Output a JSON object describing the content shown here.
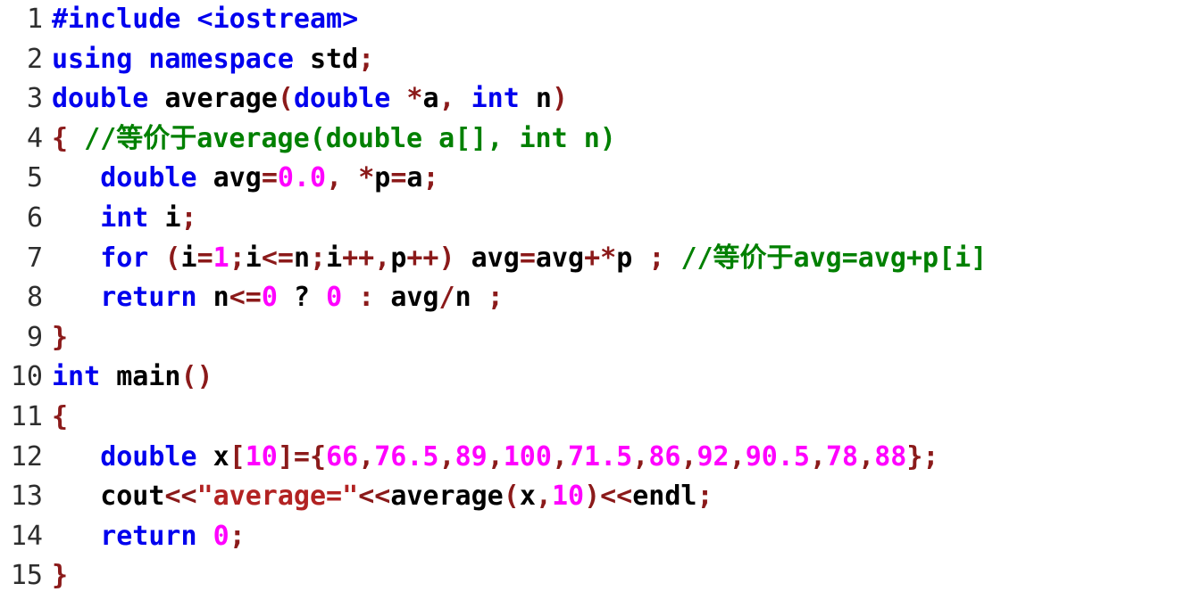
{
  "editor": {
    "language": "C++",
    "colors": {
      "background": "#ffffff",
      "line_number": "#2e2e2e",
      "keyword": "#0000ee",
      "punctuation": "#8b1a1a",
      "number": "#ff00ff",
      "string": "#b22222",
      "comment": "#008000",
      "plain": "#000000"
    },
    "lines": [
      {
        "number": "1",
        "tokens": [
          {
            "text": "#include <iostream>",
            "type": "key"
          }
        ]
      },
      {
        "number": "2",
        "tokens": [
          {
            "text": "using namespace ",
            "type": "key"
          },
          {
            "text": "std",
            "type": "plain"
          },
          {
            "text": ";",
            "type": "punc"
          }
        ]
      },
      {
        "number": "3",
        "tokens": [
          {
            "text": "double ",
            "type": "key"
          },
          {
            "text": "average",
            "type": "plain"
          },
          {
            "text": "(",
            "type": "punc"
          },
          {
            "text": "double ",
            "type": "key"
          },
          {
            "text": "*",
            "type": "punc"
          },
          {
            "text": "a",
            "type": "plain"
          },
          {
            "text": ", ",
            "type": "punc"
          },
          {
            "text": "int ",
            "type": "key"
          },
          {
            "text": "n",
            "type": "plain"
          },
          {
            "text": ")",
            "type": "punc"
          }
        ]
      },
      {
        "number": "4",
        "tokens": [
          {
            "text": "{ ",
            "type": "punc"
          },
          {
            "text": "//等价于average(double a[], int n)",
            "type": "cmt"
          }
        ]
      },
      {
        "number": "5",
        "tokens": [
          {
            "text": "   ",
            "type": "plain"
          },
          {
            "text": "double ",
            "type": "key"
          },
          {
            "text": "avg",
            "type": "plain"
          },
          {
            "text": "=",
            "type": "punc"
          },
          {
            "text": "0.0",
            "type": "num"
          },
          {
            "text": ", ",
            "type": "punc"
          },
          {
            "text": "*",
            "type": "punc"
          },
          {
            "text": "p",
            "type": "plain"
          },
          {
            "text": "=",
            "type": "punc"
          },
          {
            "text": "a",
            "type": "plain"
          },
          {
            "text": ";",
            "type": "punc"
          }
        ]
      },
      {
        "number": "6",
        "tokens": [
          {
            "text": "   ",
            "type": "plain"
          },
          {
            "text": "int ",
            "type": "key"
          },
          {
            "text": "i",
            "type": "plain"
          },
          {
            "text": ";",
            "type": "punc"
          }
        ]
      },
      {
        "number": "7",
        "tokens": [
          {
            "text": "   ",
            "type": "plain"
          },
          {
            "text": "for ",
            "type": "key"
          },
          {
            "text": "(",
            "type": "punc"
          },
          {
            "text": "i",
            "type": "plain"
          },
          {
            "text": "=",
            "type": "punc"
          },
          {
            "text": "1",
            "type": "num"
          },
          {
            "text": ";",
            "type": "punc"
          },
          {
            "text": "i",
            "type": "plain"
          },
          {
            "text": "<=",
            "type": "punc"
          },
          {
            "text": "n",
            "type": "plain"
          },
          {
            "text": ";",
            "type": "punc"
          },
          {
            "text": "i",
            "type": "plain"
          },
          {
            "text": "++",
            "type": "punc"
          },
          {
            "text": ",",
            "type": "punc"
          },
          {
            "text": "p",
            "type": "plain"
          },
          {
            "text": "++",
            "type": "punc"
          },
          {
            "text": ") ",
            "type": "punc"
          },
          {
            "text": "avg",
            "type": "plain"
          },
          {
            "text": "=",
            "type": "punc"
          },
          {
            "text": "avg",
            "type": "plain"
          },
          {
            "text": "+",
            "type": "punc"
          },
          {
            "text": "*",
            "type": "punc"
          },
          {
            "text": "p ",
            "type": "plain"
          },
          {
            "text": "; ",
            "type": "punc"
          },
          {
            "text": "//等价于avg=avg+p[i]",
            "type": "cmt"
          }
        ]
      },
      {
        "number": "8",
        "tokens": [
          {
            "text": "   ",
            "type": "plain"
          },
          {
            "text": "return ",
            "type": "key"
          },
          {
            "text": "n",
            "type": "plain"
          },
          {
            "text": "<=",
            "type": "punc"
          },
          {
            "text": "0",
            "type": "num"
          },
          {
            "text": " ? ",
            "type": "plain"
          },
          {
            "text": "0",
            "type": "num"
          },
          {
            "text": " : ",
            "type": "punc"
          },
          {
            "text": "avg",
            "type": "plain"
          },
          {
            "text": "/",
            "type": "punc"
          },
          {
            "text": "n ",
            "type": "plain"
          },
          {
            "text": ";",
            "type": "punc"
          }
        ]
      },
      {
        "number": "9",
        "tokens": [
          {
            "text": "}",
            "type": "punc"
          }
        ]
      },
      {
        "number": "10",
        "tokens": [
          {
            "text": "int ",
            "type": "key"
          },
          {
            "text": "main",
            "type": "plain"
          },
          {
            "text": "()",
            "type": "punc"
          }
        ]
      },
      {
        "number": "11",
        "tokens": [
          {
            "text": "{",
            "type": "punc"
          }
        ]
      },
      {
        "number": "12",
        "tokens": [
          {
            "text": "   ",
            "type": "plain"
          },
          {
            "text": "double ",
            "type": "key"
          },
          {
            "text": "x",
            "type": "plain"
          },
          {
            "text": "[",
            "type": "punc"
          },
          {
            "text": "10",
            "type": "num"
          },
          {
            "text": "]={",
            "type": "punc"
          },
          {
            "text": "66",
            "type": "num"
          },
          {
            "text": ",",
            "type": "punc"
          },
          {
            "text": "76.5",
            "type": "num"
          },
          {
            "text": ",",
            "type": "punc"
          },
          {
            "text": "89",
            "type": "num"
          },
          {
            "text": ",",
            "type": "punc"
          },
          {
            "text": "100",
            "type": "num"
          },
          {
            "text": ",",
            "type": "punc"
          },
          {
            "text": "71.5",
            "type": "num"
          },
          {
            "text": ",",
            "type": "punc"
          },
          {
            "text": "86",
            "type": "num"
          },
          {
            "text": ",",
            "type": "punc"
          },
          {
            "text": "92",
            "type": "num"
          },
          {
            "text": ",",
            "type": "punc"
          },
          {
            "text": "90.5",
            "type": "num"
          },
          {
            "text": ",",
            "type": "punc"
          },
          {
            "text": "78",
            "type": "num"
          },
          {
            "text": ",",
            "type": "punc"
          },
          {
            "text": "88",
            "type": "num"
          },
          {
            "text": "};",
            "type": "punc"
          }
        ]
      },
      {
        "number": "13",
        "tokens": [
          {
            "text": "   ",
            "type": "plain"
          },
          {
            "text": "cout",
            "type": "plain"
          },
          {
            "text": "<<",
            "type": "punc"
          },
          {
            "text": "\"average=\"",
            "type": "str"
          },
          {
            "text": "<<",
            "type": "punc"
          },
          {
            "text": "average",
            "type": "plain"
          },
          {
            "text": "(",
            "type": "punc"
          },
          {
            "text": "x",
            "type": "plain"
          },
          {
            "text": ",",
            "type": "punc"
          },
          {
            "text": "10",
            "type": "num"
          },
          {
            "text": ")",
            "type": "punc"
          },
          {
            "text": "<<",
            "type": "punc"
          },
          {
            "text": "endl",
            "type": "plain"
          },
          {
            "text": ";",
            "type": "punc"
          }
        ]
      },
      {
        "number": "14",
        "tokens": [
          {
            "text": "   ",
            "type": "plain"
          },
          {
            "text": "return ",
            "type": "key"
          },
          {
            "text": "0",
            "type": "num"
          },
          {
            "text": ";",
            "type": "punc"
          }
        ]
      },
      {
        "number": "15",
        "tokens": [
          {
            "text": "}",
            "type": "punc"
          }
        ]
      }
    ]
  }
}
